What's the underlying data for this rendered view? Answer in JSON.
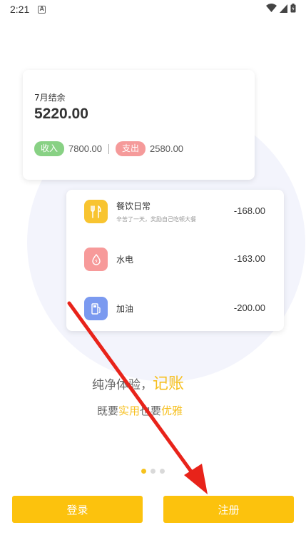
{
  "status_bar": {
    "time": "2:21",
    "notification_icon": "a-square-icon",
    "icons": [
      "wifi-icon",
      "signal-icon",
      "battery-icon"
    ]
  },
  "balance_card": {
    "month_label": "7月结余",
    "balance": "5220.00",
    "income_label": "收入",
    "income_value": "7800.00",
    "expense_label": "支出",
    "expense_value": "2580.00"
  },
  "transactions": [
    {
      "icon": "fork-knife-icon",
      "icon_color": "#f8c430",
      "name": "餐饮日常",
      "note": "辛苦了一天，奖励自己吃顿大餐",
      "amount": "-168.00"
    },
    {
      "icon": "water-drop-icon",
      "icon_color": "#f79a9a",
      "name": "水电",
      "note": "",
      "amount": "-163.00"
    },
    {
      "icon": "fuel-pump-icon",
      "icon_color": "#7b9af0",
      "name": "加油",
      "note": "",
      "amount": "-200.00"
    }
  ],
  "slogan": {
    "line1_prefix": "纯净体验，",
    "line1_highlight": "记账",
    "line2_part1": "既要",
    "line2_highlight1": "实用",
    "line2_part2": "也要",
    "line2_highlight2": "优雅"
  },
  "pager": {
    "count": 3,
    "active_index": 0
  },
  "buttons": {
    "login": "登录",
    "register": "注册"
  },
  "colors": {
    "accent": "#fcc20d",
    "income": "#88d184",
    "expense": "#f59a9a",
    "annotation_arrow": "#e8231a"
  }
}
